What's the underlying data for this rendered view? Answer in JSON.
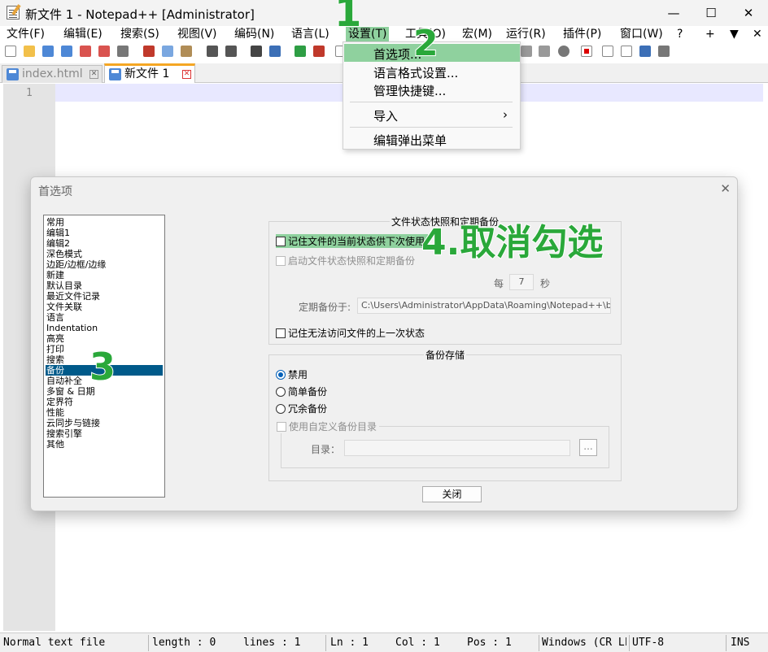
{
  "window": {
    "title": "新文件 1 - Notepad++ [Administrator]",
    "minimize": "—",
    "maximize": "☐",
    "close": "✕"
  },
  "menu": {
    "items": [
      "文件(F)",
      "编辑(E)",
      "搜索(S)",
      "视图(V)",
      "编码(N)",
      "语言(L)",
      "设置(T)",
      "工具(O)",
      "宏(M)",
      "运行(R)",
      "插件(P)",
      "窗口(W)",
      "?"
    ],
    "plus": "+",
    "dropdown_arrow": "▼",
    "close": "✕"
  },
  "tabs": [
    {
      "label": "index.html",
      "active": false
    },
    {
      "label": "新文件 1",
      "active": true
    }
  ],
  "editor": {
    "line_number": "1"
  },
  "status": {
    "file_type": "Normal text file",
    "length": "length : 0",
    "lines": "lines : 1",
    "ln": "Ln : 1",
    "col": "Col : 1",
    "pos": "Pos : 1",
    "eol": "Windows (CR LF)",
    "encoding": "UTF-8",
    "mode": "INS"
  },
  "settings_menu": {
    "items": [
      "首选项...",
      "语言格式设置...",
      "管理快捷键...",
      "导入",
      "编辑弹出菜单"
    ],
    "submenu_arrow": "›"
  },
  "preferences_dialog": {
    "title": "首选项",
    "close": "✕",
    "categories": [
      "常用",
      "编辑1",
      "编辑2",
      "深色模式",
      "边距/边框/边缘",
      "新建",
      "默认目录",
      "最近文件记录",
      "文件关联",
      "语言",
      "Indentation",
      "高亮",
      "打印",
      "搜索",
      "备份",
      "自动补全",
      "多窗 & 日期",
      "定界符",
      "性能",
      "云同步与链接",
      "搜索引擎",
      "其他"
    ],
    "selected_category": "备份",
    "session_group": {
      "title": "文件状态快照和定期备份",
      "remember_session": "记住文件的当前状态供下次使用",
      "enable_snapshot": "启动文件状态快照和定期备份",
      "every_label": "每",
      "every_value": "7",
      "seconds_label": "秒",
      "backup_path_label": "定期备份于:",
      "backup_path": "C:\\Users\\Administrator\\AppData\\Roaming\\Notepad++\\backup\\",
      "remember_inaccessible": "记住无法访问文件的上一次状态"
    },
    "backup_group": {
      "title": "备份存储",
      "options": [
        "禁用",
        "简单备份",
        "冗余备份"
      ],
      "selected": "禁用",
      "custom_dir": "使用自定义备份目录",
      "dir_label": "目录：",
      "browse": "..."
    },
    "close_button": "关闭"
  },
  "annotations": {
    "step1": "1",
    "step2": "2",
    "step3": "3",
    "step4": "4.取消勾选"
  },
  "colors": {
    "highlight_green": "#8fd19e",
    "annotation_green": "#2aa83a",
    "selected_blue": "#005a8a",
    "tab_accent": "#f5a623"
  }
}
